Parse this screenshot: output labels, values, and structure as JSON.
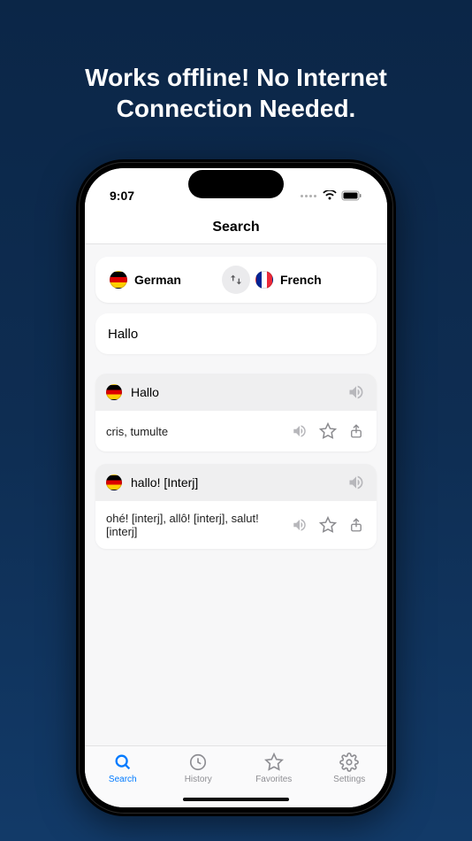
{
  "headline_line1": "Works offline! No Internet",
  "headline_line2": "Connection Needed.",
  "status": {
    "time": "9:07"
  },
  "nav": {
    "title": "Search"
  },
  "languages": {
    "source": "German",
    "target": "French"
  },
  "search": {
    "value": "Hallo"
  },
  "results": [
    {
      "word": "Hallo",
      "translation": "cris, tumulte"
    },
    {
      "word": "hallo! [Interj]",
      "translation": "ohé! [interj], allô! [interj], salut! [interj]"
    }
  ],
  "tabs": {
    "search": "Search",
    "history": "History",
    "favorites": "Favorites",
    "settings": "Settings"
  }
}
